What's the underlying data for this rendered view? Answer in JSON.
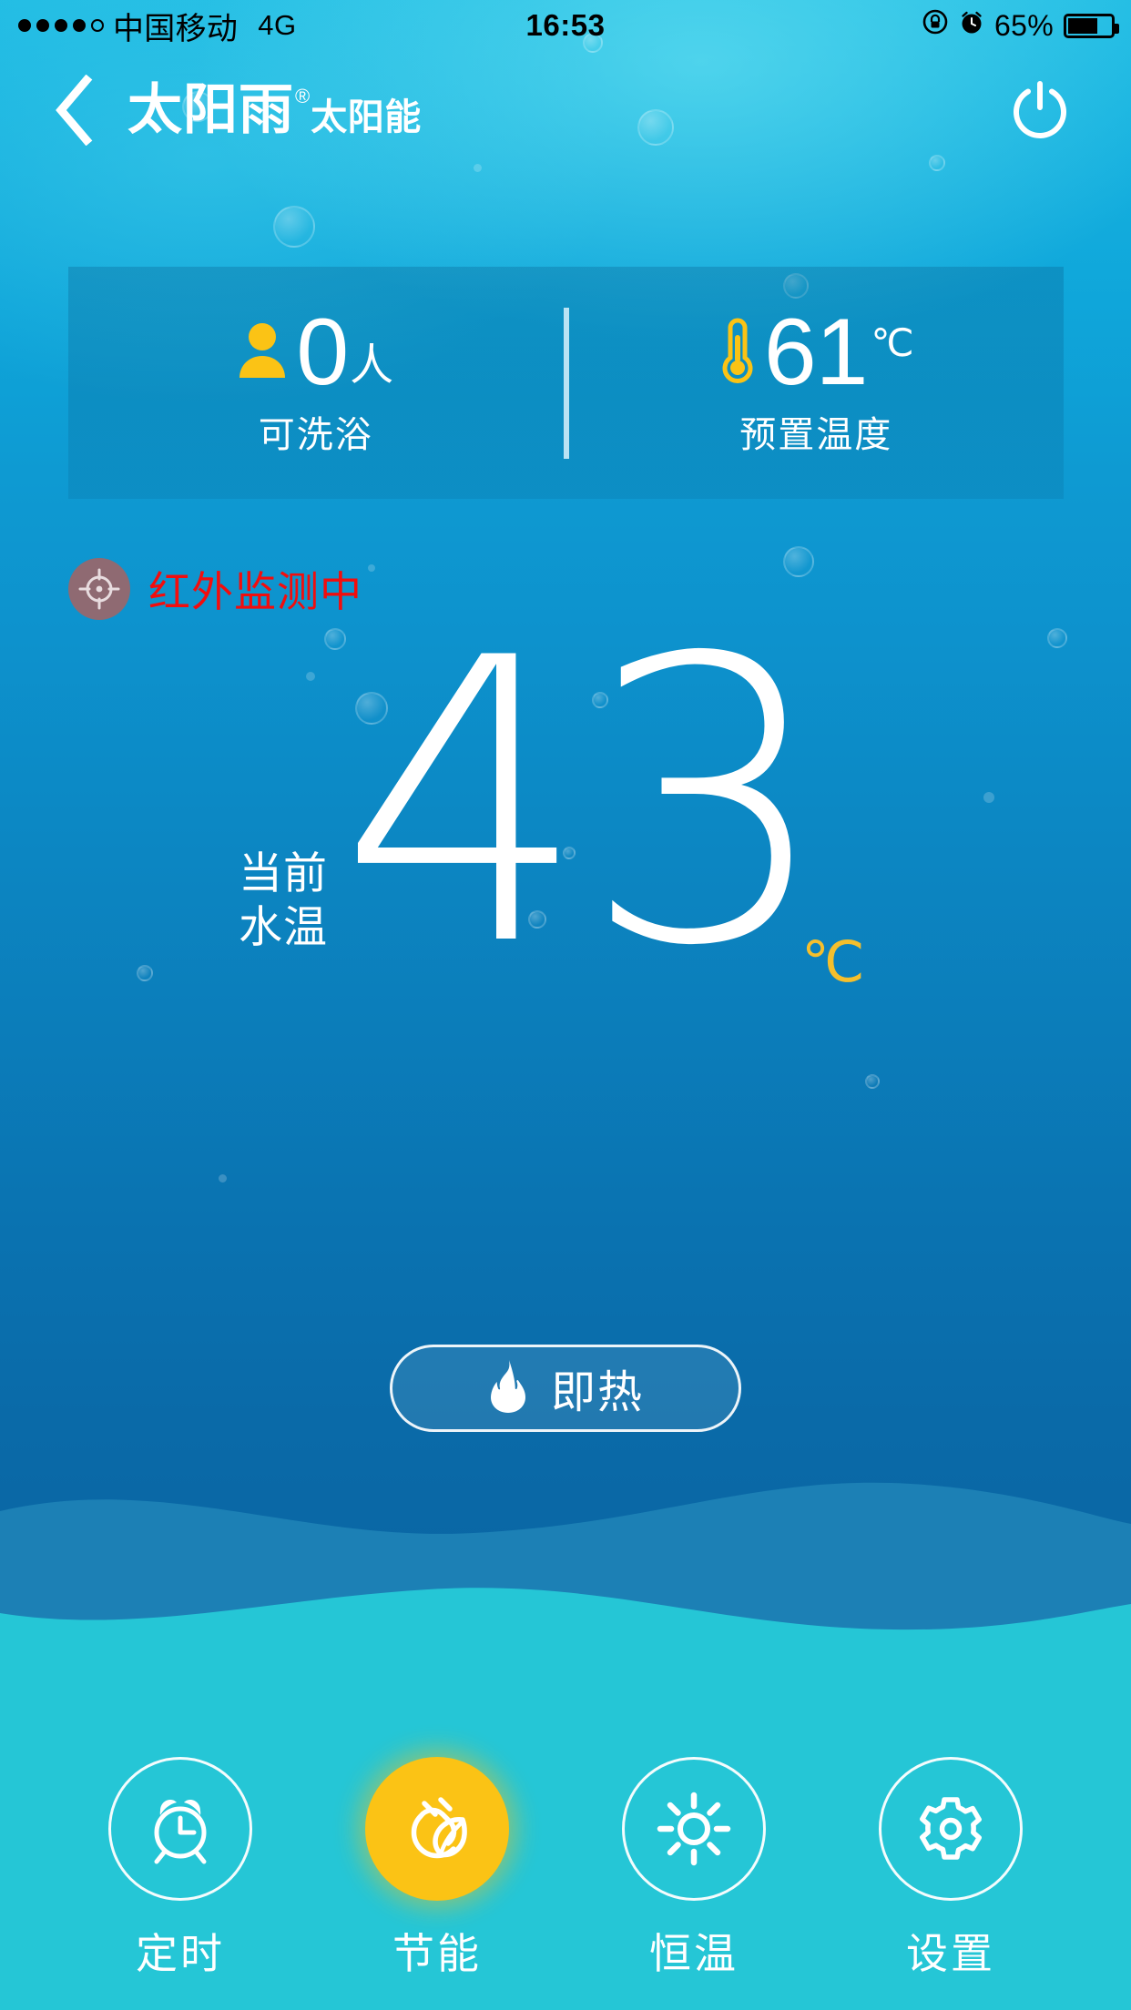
{
  "status_bar": {
    "signal_dots_filled": 4,
    "signal_dots_total": 5,
    "carrier": "中国移动",
    "network": "4G",
    "time": "16:53",
    "rotation_lock_icon": "rotation-lock-icon",
    "alarm_icon": "alarm-icon",
    "battery_percent": "65%",
    "battery_level": 65
  },
  "header": {
    "back_icon": "back-chevron-icon",
    "brand_main": "太阳雨",
    "brand_reg": "®",
    "brand_sub": "太阳能",
    "power_icon": "power-icon"
  },
  "info_card": {
    "people": {
      "icon": "person-icon",
      "value": "0",
      "unit": "人",
      "label": "可洗浴"
    },
    "preset_temp": {
      "icon": "thermometer-icon",
      "value": "61",
      "unit": "℃",
      "label": "预置温度"
    }
  },
  "infrared": {
    "icon": "crosshair-target-icon",
    "text": "红外监测中",
    "color": "#f30d0d",
    "icon_bg": "#8f6a72"
  },
  "current_temp": {
    "label_line1": "当前",
    "label_line2": "水温",
    "value": "43",
    "unit": "℃",
    "unit_color": "#f5bf2c"
  },
  "heat_button": {
    "icon": "flame-icon",
    "label": "即热"
  },
  "tabbar": {
    "items": [
      {
        "id": "timer",
        "icon": "alarm-clock-icon",
        "label": "定时",
        "active": false
      },
      {
        "id": "eco",
        "icon": "plug-leaf-icon",
        "label": "节能",
        "active": true
      },
      {
        "id": "thermostat",
        "icon": "sun-icon",
        "label": "恒温",
        "active": false
      },
      {
        "id": "settings",
        "icon": "gear-icon",
        "label": "设置",
        "active": false
      }
    ]
  },
  "theme": {
    "water_top": "#1fbbe3",
    "water_bottom": "#0a67a5",
    "wave_mid": "#1c80b5",
    "bottom_bar": "#25c6d6",
    "accent_yellow": "#fbc315",
    "alert_red": "#f30d0d"
  }
}
